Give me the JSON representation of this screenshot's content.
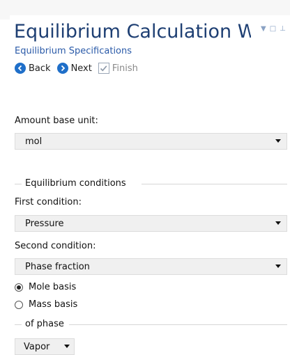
{
  "header": {
    "title": "Equilibrium Calculation Wi...",
    "subtitle": "Equilibrium Specifications"
  },
  "toolbar": {
    "back_label": "Back",
    "next_label": "Next",
    "finish_label": "Finish"
  },
  "amount": {
    "label": "Amount base unit:",
    "value": "mol"
  },
  "equilibrium_conditions": {
    "group_label": "Equilibrium conditions",
    "first_label": "First condition:",
    "first_value": "Pressure",
    "second_label": "Second condition:",
    "second_value": "Phase fraction",
    "basis_options": [
      {
        "label": "Mole basis",
        "selected": true
      },
      {
        "label": "Mass basis",
        "selected": false
      }
    ]
  },
  "of_phase": {
    "group_label": "of phase",
    "value": "Vapor"
  },
  "colors": {
    "title": "#1e3f73",
    "subtitle": "#2a5aa8",
    "accent": "#1f6fc9"
  }
}
